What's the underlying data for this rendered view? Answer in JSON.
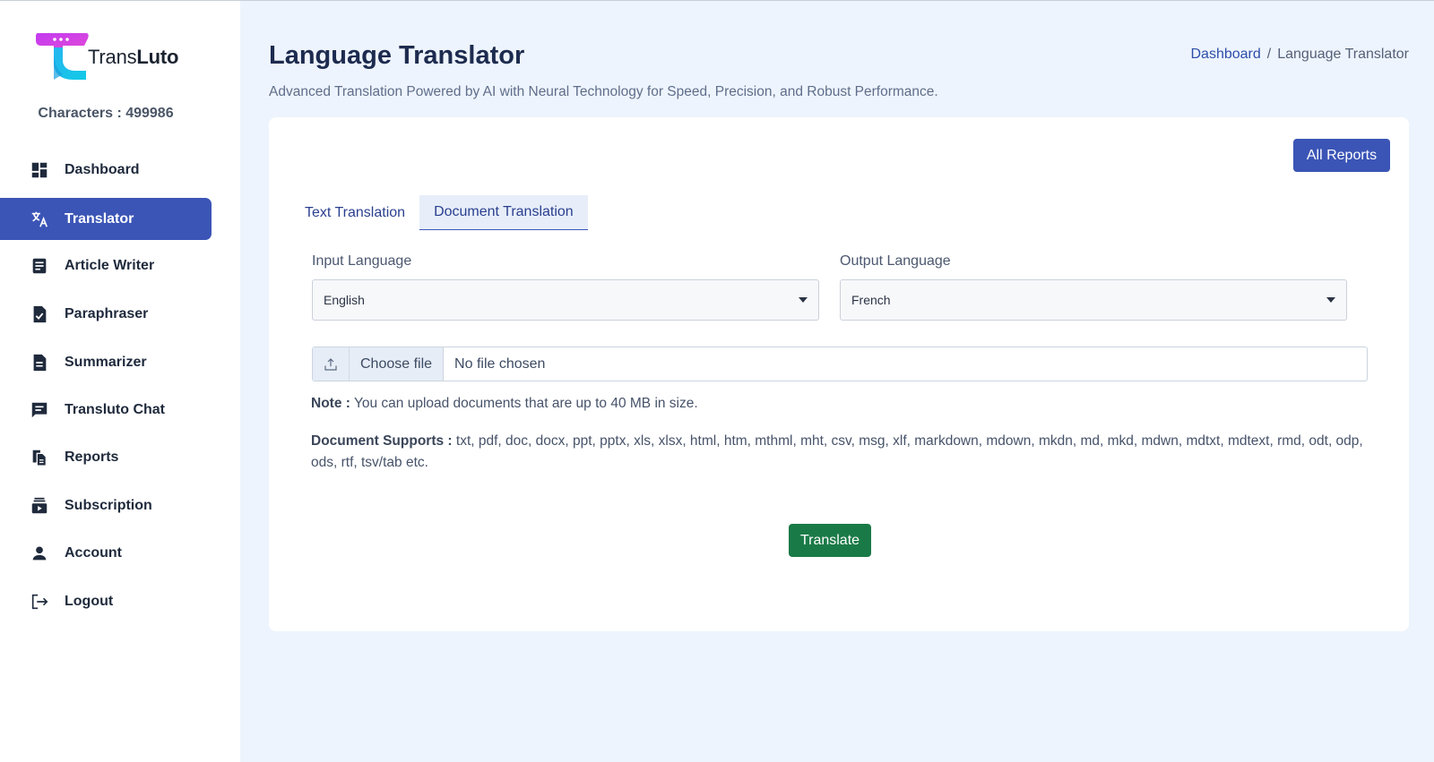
{
  "brand": {
    "name_light": "Trans",
    "name_bold": "Luto"
  },
  "characters_label": "Characters : 499986",
  "sidebar": {
    "items": [
      {
        "label": "Dashboard",
        "icon": "dashboard-icon"
      },
      {
        "label": "Translator",
        "icon": "translate-icon",
        "active": true
      },
      {
        "label": "Article Writer",
        "icon": "article-icon"
      },
      {
        "label": "Paraphraser",
        "icon": "paraphrase-icon"
      },
      {
        "label": "Summarizer",
        "icon": "summarize-icon"
      },
      {
        "label": "Transluto Chat",
        "icon": "chat-icon"
      },
      {
        "label": "Reports",
        "icon": "reports-icon"
      },
      {
        "label": "Subscription",
        "icon": "subscription-icon"
      },
      {
        "label": "Account",
        "icon": "account-icon"
      },
      {
        "label": "Logout",
        "icon": "logout-icon"
      }
    ]
  },
  "header": {
    "title": "Language Translator",
    "subtitle": "Advanced Translation Powered by AI with Neural Technology for Speed, Precision, and Robust Performance.",
    "breadcrumb": {
      "link": "Dashboard",
      "separator": "/",
      "current": "Language Translator"
    }
  },
  "card": {
    "all_reports_label": "All Reports",
    "tabs": [
      {
        "label": "Text Translation",
        "active": false
      },
      {
        "label": "Document Translation",
        "active": true
      }
    ],
    "input_language": {
      "label": "Input Language",
      "value": "English"
    },
    "output_language": {
      "label": "Output Language",
      "value": "French"
    },
    "file": {
      "button_label": "Choose file",
      "status": "No file chosen"
    },
    "note": {
      "label": "Note :",
      "text": " You can upload documents that are up to 40 MB in size."
    },
    "supports": {
      "label": "Document Supports :",
      "text": " txt, pdf, doc, docx, ppt, pptx, xls, xlsx, html, htm, mthml, mht, csv, msg, xlf, markdown, mdown, mkdn, md, mkd, mdwn, mdtxt, mdtext, rmd, odt, odp, ods, rtf, tsv/tab etc."
    },
    "translate_label": "Translate"
  },
  "colors": {
    "accent": "#3b55b6",
    "success": "#1a7a47",
    "background": "#eef4fd"
  }
}
